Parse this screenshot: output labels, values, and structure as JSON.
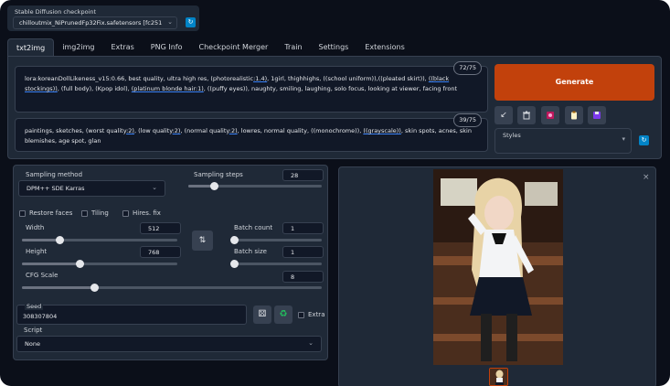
{
  "checkpoint": {
    "label": "Stable Diffusion checkpoint",
    "value": "chilloutmix_NiPrunedFp32Fix.safetensors [fc251"
  },
  "tabs": [
    "txt2img",
    "img2img",
    "Extras",
    "PNG Info",
    "Checkpoint Merger",
    "Train",
    "Settings",
    "Extensions"
  ],
  "prompt": {
    "counter": "72/75",
    "parts": [
      "lora:koreanDollLikeness_v15:0.66, best quality, ultra high res, (photorealistic",
      ":1.4)",
      ", 1girl, thighhighs, ((school uniform)),((pleated skirt)), ",
      "((black stockings))",
      ", (full body), (Kpop idol), ",
      "(platinum blonde hair",
      ":1)",
      ", ((puffy eyes)), naughty, smiling, laughing, solo focus, looking at viewer, facing front"
    ]
  },
  "negative_prompt": {
    "counter": "39/75",
    "parts": [
      "paintings, sketches, (worst quality",
      ":2)",
      ", (low quality",
      ":2)",
      ", (normal quality",
      ":2)",
      ", lowres, normal quality, ((monochrome)), ",
      "((grayscale))",
      ", skin spots, acnes, skin blemishes, age spot, glan"
    ]
  },
  "generate_label": "Generate",
  "styles_label": "Styles",
  "sampling": {
    "method_label": "Sampling method",
    "method_value": "DPM++ SDE Karras",
    "steps_label": "Sampling steps",
    "steps_value": "28",
    "steps_fraction": 0.19
  },
  "options": {
    "restore_faces": "Restore faces",
    "tiling": "Tiling",
    "hires_fix": "Hires. fix"
  },
  "width": {
    "label": "Width",
    "value": "512",
    "fraction": 0.24
  },
  "height": {
    "label": "Height",
    "value": "768",
    "fraction": 0.37
  },
  "batch_count": {
    "label": "Batch count",
    "value": "1",
    "fraction": 0.0
  },
  "batch_size": {
    "label": "Batch size",
    "value": "1",
    "fraction": 0.0
  },
  "cfg": {
    "label": "CFG Scale",
    "value": "8",
    "fraction": 0.24
  },
  "seed": {
    "label": "Seed",
    "value": "308307804",
    "extra_label": "Extra"
  },
  "script": {
    "label": "Script",
    "value": "None"
  },
  "icons": {
    "refresh": "refresh-icon",
    "arrow": "arrow-icon",
    "trash": "trash-icon",
    "art": "art-icon",
    "clipboard": "clipboard-icon",
    "save": "save-icon",
    "swap": "swap-icon",
    "dice": "dice-icon",
    "recycle": "recycle-icon",
    "close": "close-icon"
  },
  "colors": {
    "accent": "#c2410c",
    "refresh": "#0284c7",
    "background": "#0b0f19",
    "panel": "#1f2937"
  }
}
